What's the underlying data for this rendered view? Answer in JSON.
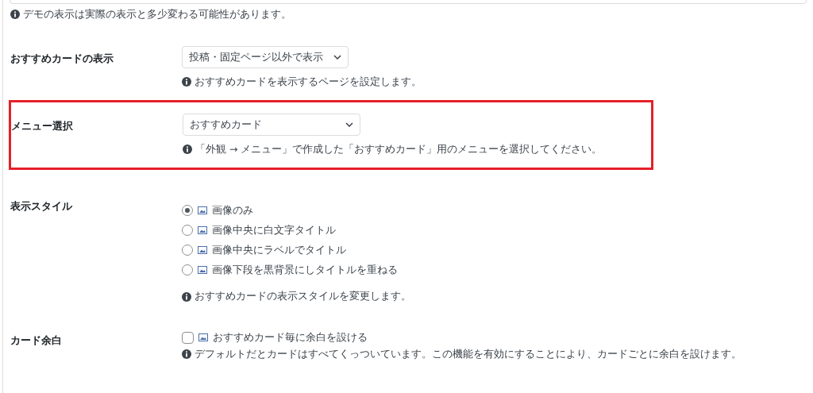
{
  "demo_note": "デモの表示は実際の表示と多少変わる可能性があります。",
  "settings": [
    {
      "kind": "select",
      "label": "おすすめカードの表示",
      "value": "投稿・固定ページ以外で表示",
      "highlighted": false,
      "note": "おすすめカードを表示するページを設定します。"
    },
    {
      "kind": "select",
      "label": "メニュー選択",
      "value": "おすすめカード",
      "highlighted": true,
      "note": "「外観 → メニュー」で作成した「おすすめカード」用のメニューを選択してください。"
    },
    {
      "kind": "radio",
      "label": "表示スタイル",
      "highlighted": false,
      "options": [
        {
          "label": "画像のみ",
          "selected": true
        },
        {
          "label": "画像中央に白文字タイトル",
          "selected": false
        },
        {
          "label": "画像中央にラベルでタイトル",
          "selected": false
        },
        {
          "label": "画像下段を黒背景にしタイトルを重ねる",
          "selected": false
        }
      ],
      "note": "おすすめカードの表示スタイルを変更します。"
    },
    {
      "kind": "checkbox",
      "label": "カード余白",
      "highlighted": false,
      "option": "おすすめカード毎に余白を設ける",
      "checked": false,
      "note": "デフォルトだとカードはすべてくっついています。この機能を有効にすることにより、カードごとに余白を設けます。"
    }
  ]
}
